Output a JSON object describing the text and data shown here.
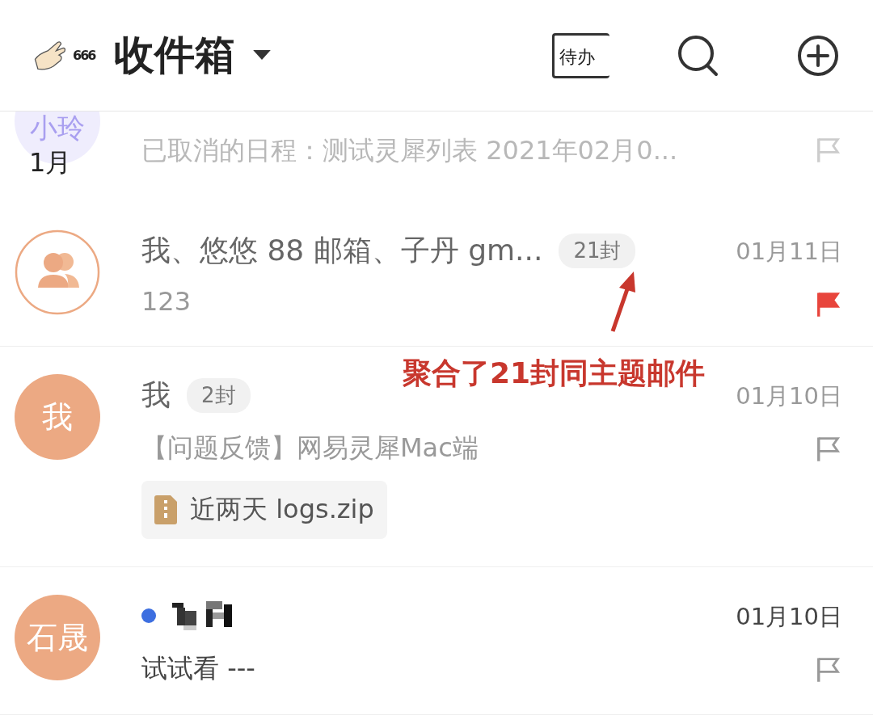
{
  "header": {
    "logo_text": "666",
    "title": "收件箱",
    "todo_label": "待办"
  },
  "section_label": "1月",
  "messages": [
    {
      "kind": "faded",
      "avatar": "小玲",
      "preview": "已取消的日程：测试灵犀列表 2021年02月0...",
      "flagged": false,
      "unread": false
    },
    {
      "kind": "group",
      "sender": "我、悠悠 88 邮箱、子丹 gm...",
      "count": "21封",
      "date": "01月11日",
      "preview": "123",
      "flagged": true,
      "unread": false
    },
    {
      "kind": "person",
      "avatar": "我",
      "sender": "我",
      "count": "2封",
      "date": "01月10日",
      "preview": "【问题反馈】网易灵犀Mac端",
      "attachment": "近两天 logs.zip",
      "flagged": false,
      "unread": false
    },
    {
      "kind": "hidden",
      "avatar": "石晟",
      "date": "01月10日",
      "preview": "试试看 ---",
      "flagged": false,
      "unread": true
    }
  ],
  "annotation": {
    "text": "聚合了21封同主题邮件"
  }
}
